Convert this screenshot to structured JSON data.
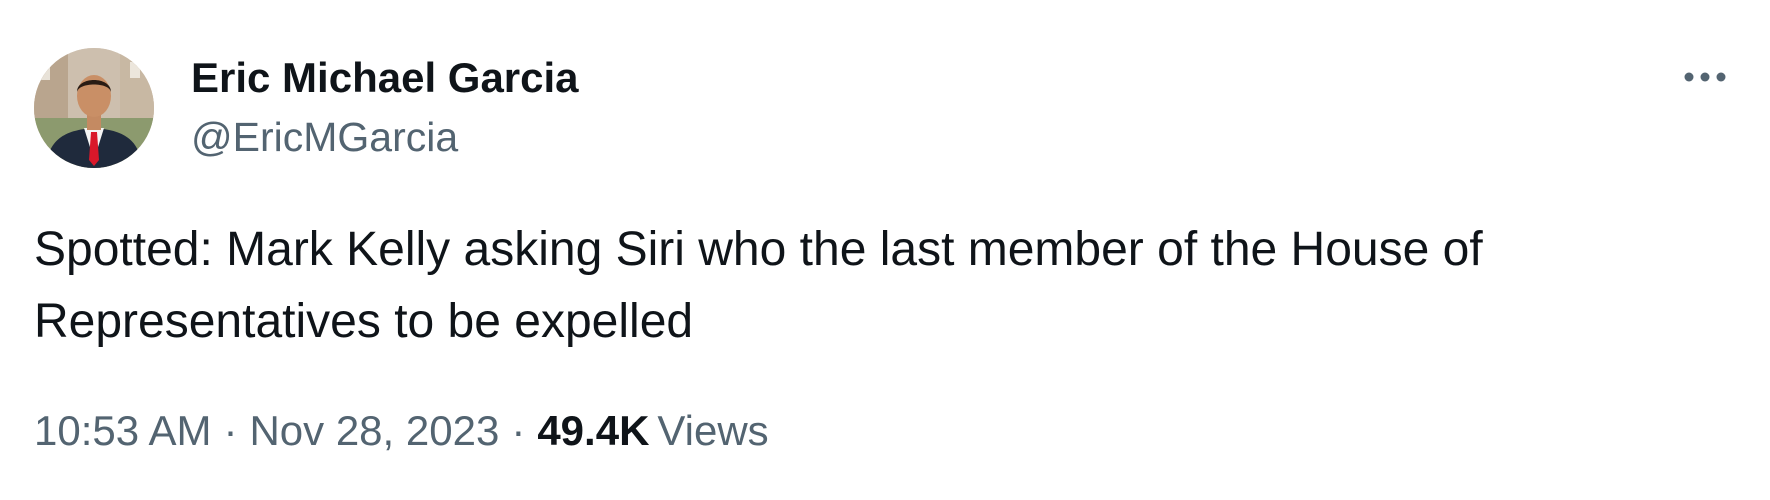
{
  "author": {
    "display_name": "Eric Michael Garcia",
    "handle": "@EricMGarcia",
    "avatar_icon": "profile-photo"
  },
  "more_menu": {
    "icon": "more-horizontal-icon"
  },
  "tweet": {
    "text": "Spotted: Mark Kelly asking Siri who the last member of the House of\nRepresentatives to be expelled"
  },
  "meta": {
    "time": "10:53 AM",
    "separator": "·",
    "date": "Nov 28, 2023",
    "views_count": "49.4K",
    "views_label": "Views"
  },
  "colors": {
    "text_primary": "#0f1419",
    "text_secondary": "#536471",
    "tie_red": "#d9182a"
  }
}
